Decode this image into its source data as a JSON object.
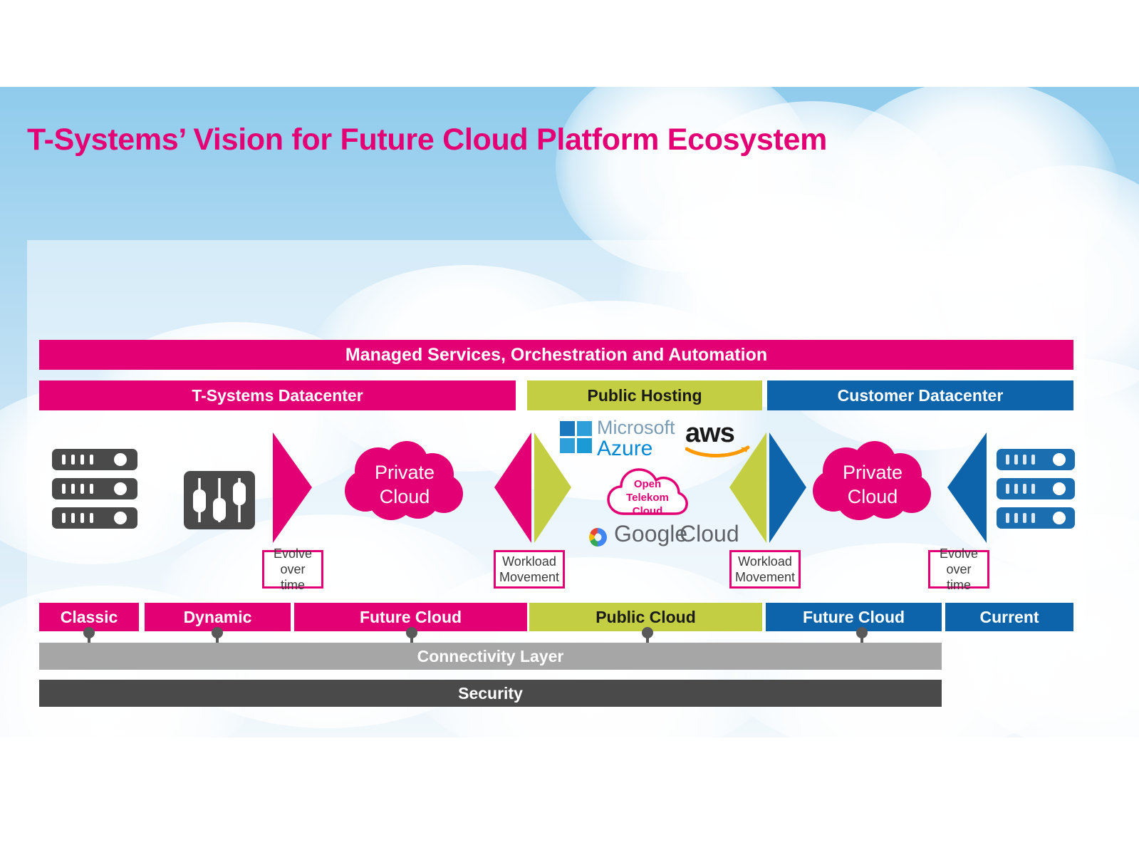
{
  "slide": {
    "title": "T-Systems’ Vision for Future Cloud Platform Ecosystem",
    "accent_magenta": "#e20074",
    "accent_olive": "#c4ce43",
    "accent_blue": "#0d64ab",
    "accent_gray": "#a6a6a6",
    "accent_darkgray": "#4a4a4a",
    "sky_background": "#a8d6f0"
  },
  "header_bars": {
    "managed": "Managed Services, Orchestration and Automation",
    "columns": [
      {
        "label": "T-Systems Datacenter",
        "color": "#e20074"
      },
      {
        "label": "Public Hosting",
        "color": "#c4ce43"
      },
      {
        "label": "Customer Datacenter",
        "color": "#0d64ab"
      }
    ]
  },
  "diagram": {
    "left_servers_icon": "server-rack-icon",
    "left_sliders_icon": "sliders-icon",
    "right_servers_icon": "server-rack-icon",
    "private_cloud_left": "Private\nCloud",
    "private_cloud_left_line1": "Private",
    "private_cloud_left_line2": "Cloud",
    "private_cloud_right_line1": "Private",
    "private_cloud_right_line2": "Cloud",
    "open_telekom_cloud": [
      "Open",
      "Telekom",
      "Cloud"
    ],
    "providers": [
      {
        "name": "microsoft-azure-logo",
        "line1": "Microsoft",
        "line2": "Azure"
      },
      {
        "name": "aws-logo",
        "text": "aws"
      },
      {
        "name": "open-telekom-cloud-logo",
        "text": "Open Telekom Cloud"
      },
      {
        "name": "google-cloud-logo",
        "word1": "Google",
        "word2": "Cloud"
      }
    ],
    "arrows": [
      {
        "name": "arrow-evolve-left",
        "direction": "right",
        "color": "#e20074"
      },
      {
        "name": "arrow-workload-mid",
        "direction": "both",
        "left_color": "#e20074",
        "right_color": "#c4ce43"
      },
      {
        "name": "arrow-workload-right",
        "direction": "both",
        "left_color": "#c4ce43",
        "right_color": "#0d64ab"
      },
      {
        "name": "arrow-evolve-right",
        "direction": "left",
        "color": "#0d64ab"
      }
    ],
    "callouts": [
      {
        "line1": "Evolve",
        "line2": "over time"
      },
      {
        "line1": "Workload",
        "line2": "Movement"
      },
      {
        "line1": "Workload",
        "line2": "Movement"
      },
      {
        "line1": "Evolve",
        "line2": "over time"
      }
    ]
  },
  "footer_bars": {
    "segments": [
      {
        "label": "Classic",
        "color": "#e20074"
      },
      {
        "label": "Dynamic",
        "color": "#e20074"
      },
      {
        "label": "Future Cloud",
        "color": "#e20074"
      },
      {
        "label": "Public Cloud",
        "color": "#c4ce43"
      },
      {
        "label": "Future Cloud",
        "color": "#0d64ab"
      },
      {
        "label": "Current",
        "color": "#0d64ab"
      }
    ],
    "connectivity": "Connectivity Layer",
    "security": "Security"
  }
}
